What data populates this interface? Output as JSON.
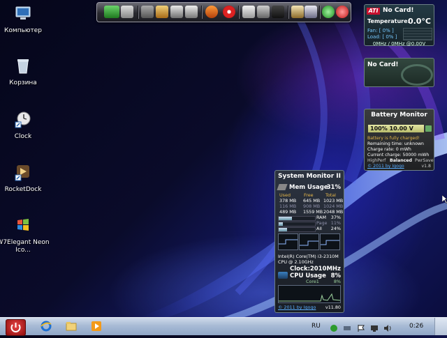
{
  "desktop_icons": [
    {
      "label": "Компьютер",
      "icon": "computer-icon"
    },
    {
      "label": "Корзина",
      "icon": "recycle-bin-icon"
    },
    {
      "label": "Clock",
      "icon": "clock-icon"
    },
    {
      "label": "RocketDock",
      "icon": "rocketdock-icon"
    },
    {
      "label": "W7Elegant Neon Ico...",
      "icon": "windows-flag-icon"
    }
  ],
  "dock": {
    "items": [
      "monitor-icon",
      "tools-icon",
      "cable-icon",
      "photos-icon",
      "gear-icon",
      "paint-icon",
      "hero-icon",
      "magnet-icon",
      "archive-icon",
      "folders-icon",
      "disk-icon",
      "toolbox-icon",
      "media-icon",
      "accept-icon",
      "power-icon"
    ]
  },
  "ati_gadget": {
    "logo": "ATI",
    "title": "No Card!",
    "temperature_label": "Temperature:",
    "temperature_value": "0.0°C",
    "fan": "Fan: [ 0% ]",
    "load": "Load: [ 0% ]",
    "clocks": "0MHz / 0MHz @0.00V"
  },
  "nvidia_gadget": {
    "title": "No Card!"
  },
  "battery_monitor": {
    "title": "Battery Monitor",
    "meter_text": "100%  10.00 V",
    "level_pct": 100,
    "status": "Battery is fully charged!",
    "remaining": "Remaining time: unknown",
    "charge_rate": "Charge rate: 0 mWh",
    "current_charge": "Current charge: 50000 mWh",
    "modes": [
      "HighPerf",
      "Balanced",
      "PwrSave"
    ],
    "active_mode": "Balanced",
    "copyright": "© 2011 by Igogo",
    "version": "v1.8"
  },
  "system_monitor": {
    "title": "System Monitor II",
    "mem_label": "Mem Usage",
    "mem_value": "31%",
    "columns": [
      "Used",
      "Free",
      "Total"
    ],
    "rows": [
      [
        "378 MB",
        "645 MB",
        "1023 MB"
      ],
      [
        "116 MB",
        "908 MB",
        "1024 MB"
      ],
      [
        "489 MB",
        "1559 MB",
        "2048 MB"
      ]
    ],
    "meters": [
      {
        "label": "RAM",
        "value": "37%",
        "pct": 37
      },
      {
        "label": "Page",
        "value": "11%",
        "pct": 11
      },
      {
        "label": "All",
        "value": "24%",
        "pct": 24
      }
    ],
    "cpu_name": "Intel(R) Core(TM) i3-2310M",
    "cpu_speed": "CPU @ 2.10GHz",
    "clock_label": "Clock:",
    "clock_value": "2010MHz",
    "cpu_usage_label": "CPU Usage",
    "cpu_usage_value": "8%",
    "core_label": "Core1",
    "core_value": "8%",
    "copyright": "© 2011 by Igogo",
    "version": "v11.80"
  },
  "taskbar": {
    "start": "start-button",
    "pinned": [
      "internet-explorer-icon",
      "explorer-folder-icon",
      "media-player-icon"
    ],
    "language": "RU",
    "tray": [
      "security-icon",
      "network-icon",
      "flag-icon",
      "display-icon",
      "volume-icon"
    ],
    "clock": "0:26"
  },
  "colors": {
    "battery_meter": "#d4d88a",
    "link": "#5aaeff",
    "start_button": "#c41e1e",
    "taskbar": "#b3c4dc"
  }
}
